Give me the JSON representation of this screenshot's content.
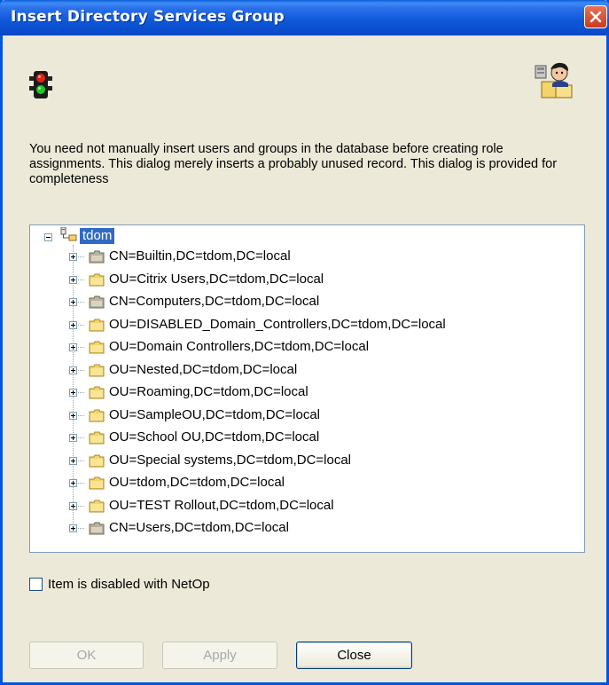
{
  "window": {
    "title": "Insert Directory Services Group"
  },
  "icons": {
    "left": "traffic-light-icon",
    "right": "directory-user-icon",
    "close": "close-icon"
  },
  "description": "You need not manually insert users and groups in the database before creating role assignments. This dialog merely inserts a probably unused record. This dialog is provided for completeness",
  "tree": {
    "root": {
      "label": "tdom",
      "selected": true,
      "expanded": true
    },
    "items": [
      {
        "label": "CN=Builtin,DC=tdom,DC=local",
        "type": "container"
      },
      {
        "label": "OU=Citrix Users,DC=tdom,DC=local",
        "type": "ou"
      },
      {
        "label": "CN=Computers,DC=tdom,DC=local",
        "type": "container"
      },
      {
        "label": "OU=DISABLED_Domain_Controllers,DC=tdom,DC=local",
        "type": "ou"
      },
      {
        "label": "OU=Domain Controllers,DC=tdom,DC=local",
        "type": "ou"
      },
      {
        "label": "OU=Nested,DC=tdom,DC=local",
        "type": "ou"
      },
      {
        "label": "OU=Roaming,DC=tdom,DC=local",
        "type": "ou"
      },
      {
        "label": "OU=SampleOU,DC=tdom,DC=local",
        "type": "ou"
      },
      {
        "label": "OU=School OU,DC=tdom,DC=local",
        "type": "ou"
      },
      {
        "label": "OU=Special systems,DC=tdom,DC=local",
        "type": "ou"
      },
      {
        "label": "OU=tdom,DC=tdom,DC=local",
        "type": "ou"
      },
      {
        "label": "OU=TEST Rollout,DC=tdom,DC=local",
        "type": "ou"
      },
      {
        "label": "CN=Users,DC=tdom,DC=local",
        "type": "container"
      }
    ]
  },
  "checkbox": {
    "label": "Item is disabled with NetOp",
    "checked": false
  },
  "buttons": {
    "ok": {
      "label": "OK",
      "enabled": false
    },
    "apply": {
      "label": "Apply",
      "enabled": false
    },
    "close": {
      "label": "Close",
      "enabled": true
    }
  },
  "colors": {
    "titlebar": "#0a4ccc",
    "selection": "#316ac5",
    "face": "#ece9d8",
    "folder": "#f3d36a",
    "container_folder": "#b8b39e"
  }
}
